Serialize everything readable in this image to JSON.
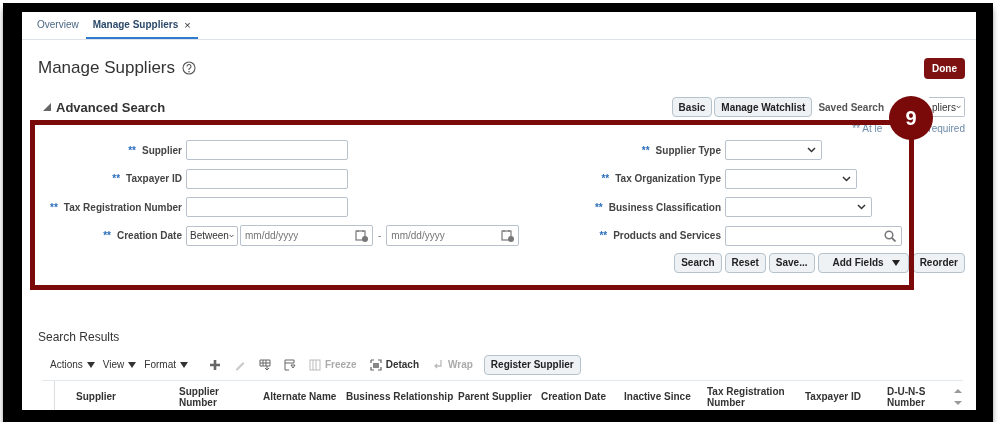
{
  "tabs": [
    {
      "label": "Overview",
      "selected": false
    },
    {
      "label": "Manage Suppliers",
      "selected": true,
      "close": "×"
    }
  ],
  "page": {
    "title": "Manage Suppliers",
    "primary_button": "Done"
  },
  "advanced_search": {
    "title": "Advanced Search",
    "expanded": true,
    "buttons": [
      "Basic",
      "Manage Watchlist"
    ],
    "saved_search_label": "Saved Search",
    "saved_search_value": "pliers",
    "note_start": "** At le",
    "note_end": "required"
  },
  "left_fields": [
    {
      "mark": "**",
      "label": "Supplier",
      "kind": "text"
    },
    {
      "mark": "**",
      "label": "Taxpayer ID",
      "kind": "text"
    },
    {
      "mark": "**",
      "label": "Tax Registration Number",
      "kind": "text"
    },
    {
      "mark": "**",
      "label": "Creation Date",
      "kind": "daterange",
      "operator": "Between",
      "from_placeholder": "mm/dd/yyyy",
      "separator": "-",
      "to_placeholder": "mm/dd/yyyy"
    }
  ],
  "right_fields": [
    {
      "mark": "**",
      "label": "Supplier Type",
      "kind": "select"
    },
    {
      "mark": "**",
      "label": "Tax Organization Type",
      "kind": "select"
    },
    {
      "mark": "**",
      "label": "Business Classification",
      "kind": "select"
    },
    {
      "mark": "**",
      "label": "Products and Services",
      "kind": "lookup"
    }
  ],
  "search_buttons": [
    {
      "label": "Search",
      "kind": "button"
    },
    {
      "label": "Reset",
      "kind": "button"
    },
    {
      "label": "Save...",
      "kind": "button"
    },
    {
      "label": "Add Fields",
      "kind": "menu"
    },
    {
      "label": "Reorder",
      "kind": "button"
    }
  ],
  "annotation": {
    "number": "9"
  },
  "results": {
    "title": "Search Results",
    "toolbar": [
      {
        "kind": "menu",
        "label": "Actions",
        "disabled": false
      },
      {
        "kind": "menu",
        "label": "View",
        "disabled": false
      },
      {
        "kind": "menu",
        "label": "Format",
        "disabled": false
      },
      {
        "kind": "add",
        "disabled": false
      },
      {
        "kind": "edit",
        "disabled": true
      },
      {
        "kind": "columns",
        "disabled": false
      },
      {
        "kind": "filter",
        "disabled": false
      },
      {
        "kind": "freeze",
        "label": "Freeze",
        "disabled": true
      },
      {
        "kind": "detach",
        "label": "Detach",
        "disabled": false
      },
      {
        "kind": "wrap",
        "label": "Wrap",
        "disabled": true
      },
      {
        "kind": "button",
        "label": "Register Supplier",
        "disabled": false
      }
    ],
    "columns": [
      "Supplier",
      "Supplier Number",
      "Alternate Name",
      "Business Relationship",
      "Parent Supplier",
      "Creation Date",
      "Inactive Since",
      "Tax Registration Number",
      "Taxpayer ID",
      "D-U-N-S Number"
    ]
  }
}
